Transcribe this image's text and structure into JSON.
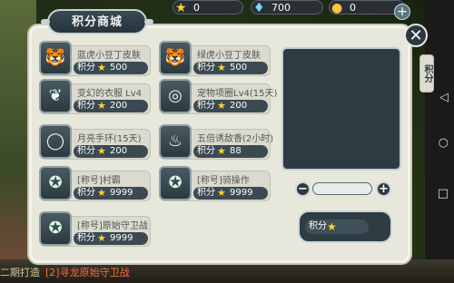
{
  "topbar": {
    "resources": [
      {
        "icon": "star-icon",
        "value": "0"
      },
      {
        "icon": "diamond-icon",
        "value": "700"
      },
      {
        "icon": "coin-icon",
        "value": "0"
      }
    ],
    "add_label": "+"
  },
  "dialog": {
    "title": "积分商城",
    "close_label": "✕",
    "side_tab_label": "积分"
  },
  "items": [
    {
      "name": "蓝虎小豆丁皮肤",
      "price_label": "积分",
      "price": "500",
      "icon": "tiger-skin-icon"
    },
    {
      "name": "绿虎小豆丁皮肤",
      "price_label": "积分",
      "price": "500",
      "icon": "tiger-skin-icon"
    },
    {
      "name": "变幻的衣服 Lv4",
      "price_label": "积分",
      "price": "200",
      "icon": "clothes-icon"
    },
    {
      "name": "宠物项圈Lv4(15天)",
      "price_label": "积分",
      "price": "200",
      "icon": "collar-icon"
    },
    {
      "name": "月亮手环(15天)",
      "price_label": "积分",
      "price": "200",
      "icon": "bracelet-icon"
    },
    {
      "name": "五倍诱敌香(2小时)",
      "price_label": "积分",
      "price": "88",
      "icon": "incense-icon"
    },
    {
      "name": "[称号]村霸",
      "price_label": "积分",
      "price": "9999",
      "icon": "title-badge-icon"
    },
    {
      "name": "[称号]骑操作",
      "price_label": "积分",
      "price": "9999",
      "icon": "title-badge-icon"
    },
    {
      "name": "[称号]原始守卫战",
      "price_label": "积分",
      "price": "9999",
      "icon": "title-badge-icon"
    }
  ],
  "purchase": {
    "minus_label": "−",
    "plus_label": "+",
    "buy_label": "积分"
  },
  "background": {
    "bottom_text": "二期打造",
    "bottom_text_hl": "[2]寻龙原始守卫战"
  },
  "colors": {
    "panel_dark": "#2d3b42",
    "dialog_bg": "#e7e7dc",
    "star": "#ffd23a"
  }
}
